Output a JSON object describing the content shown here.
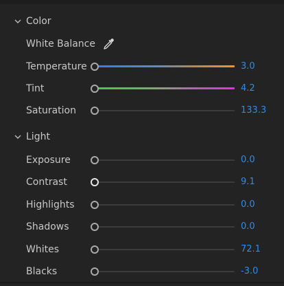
{
  "sections": {
    "color": {
      "title": "Color"
    },
    "light": {
      "title": "Light"
    }
  },
  "color": {
    "white_balance": {
      "label": "White Balance",
      "icon": "eyedropper-icon"
    },
    "temperature": {
      "label": "Temperature",
      "value": "3.0"
    },
    "tint": {
      "label": "Tint",
      "value": "4.2"
    },
    "saturation": {
      "label": "Saturation",
      "value": "133.3"
    }
  },
  "light": {
    "exposure": {
      "label": "Exposure",
      "value": "0.0"
    },
    "contrast": {
      "label": "Contrast",
      "value": "9.1"
    },
    "highlights": {
      "label": "Highlights",
      "value": "0.0"
    },
    "shadows": {
      "label": "Shadows",
      "value": "0.0"
    },
    "whites": {
      "label": "Whites",
      "value": "72.1"
    },
    "blacks": {
      "label": "Blacks",
      "value": "-3.0"
    }
  },
  "colors": {
    "panel_bg": "#232323",
    "label": "#c8c8c8",
    "value_accent": "#2d8ceb",
    "temperature_start": "#2f7df6",
    "temperature_end": "#f3922f",
    "tint_start": "#3fcf3f",
    "tint_end": "#e92fe4"
  }
}
